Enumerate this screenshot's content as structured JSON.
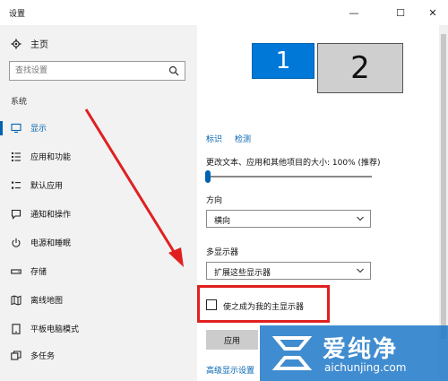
{
  "window": {
    "title": "设置",
    "minimize_glyph": "—",
    "maximize_glyph": "☐",
    "close_glyph": "✕"
  },
  "sidebar": {
    "home_label": "主页",
    "search_placeholder": "查找设置",
    "section_label": "系统",
    "items": [
      {
        "label": "显示",
        "icon": "monitor-icon",
        "active": true
      },
      {
        "label": "应用和功能",
        "icon": "apps-list-icon"
      },
      {
        "label": "默认应用",
        "icon": "default-apps-icon"
      },
      {
        "label": "通知和操作",
        "icon": "notification-icon"
      },
      {
        "label": "电源和睡眠",
        "icon": "power-icon"
      },
      {
        "label": "存储",
        "icon": "storage-icon"
      },
      {
        "label": "离线地图",
        "icon": "map-icon"
      },
      {
        "label": "平板电脑模式",
        "icon": "tablet-icon"
      },
      {
        "label": "多任务",
        "icon": "multitask-icon"
      }
    ]
  },
  "main": {
    "monitors": [
      {
        "number": "1",
        "selected": true
      },
      {
        "number": "2",
        "selected": false
      }
    ],
    "identify_link": "标识",
    "detect_link": "检测",
    "scale_label": "更改文本、应用和其他项目的大小: 100% (推荐)",
    "scale_slider_value": 0.0,
    "orientation_label": "方向",
    "orientation_value": "横向",
    "multi_display_label": "多显示器",
    "multi_display_value": "扩展这些显示器",
    "main_display_checkbox_label": "使之成为我的主显示器",
    "main_display_checked": false,
    "apply_button": "应用",
    "advanced_link": "高级显示设置"
  },
  "watermark": {
    "title": "爱纯净",
    "subtitle": "aichunjing.com"
  },
  "colors": {
    "accent": "#0078d7",
    "highlight_box": "#e02020",
    "arrow": "#e02020"
  }
}
